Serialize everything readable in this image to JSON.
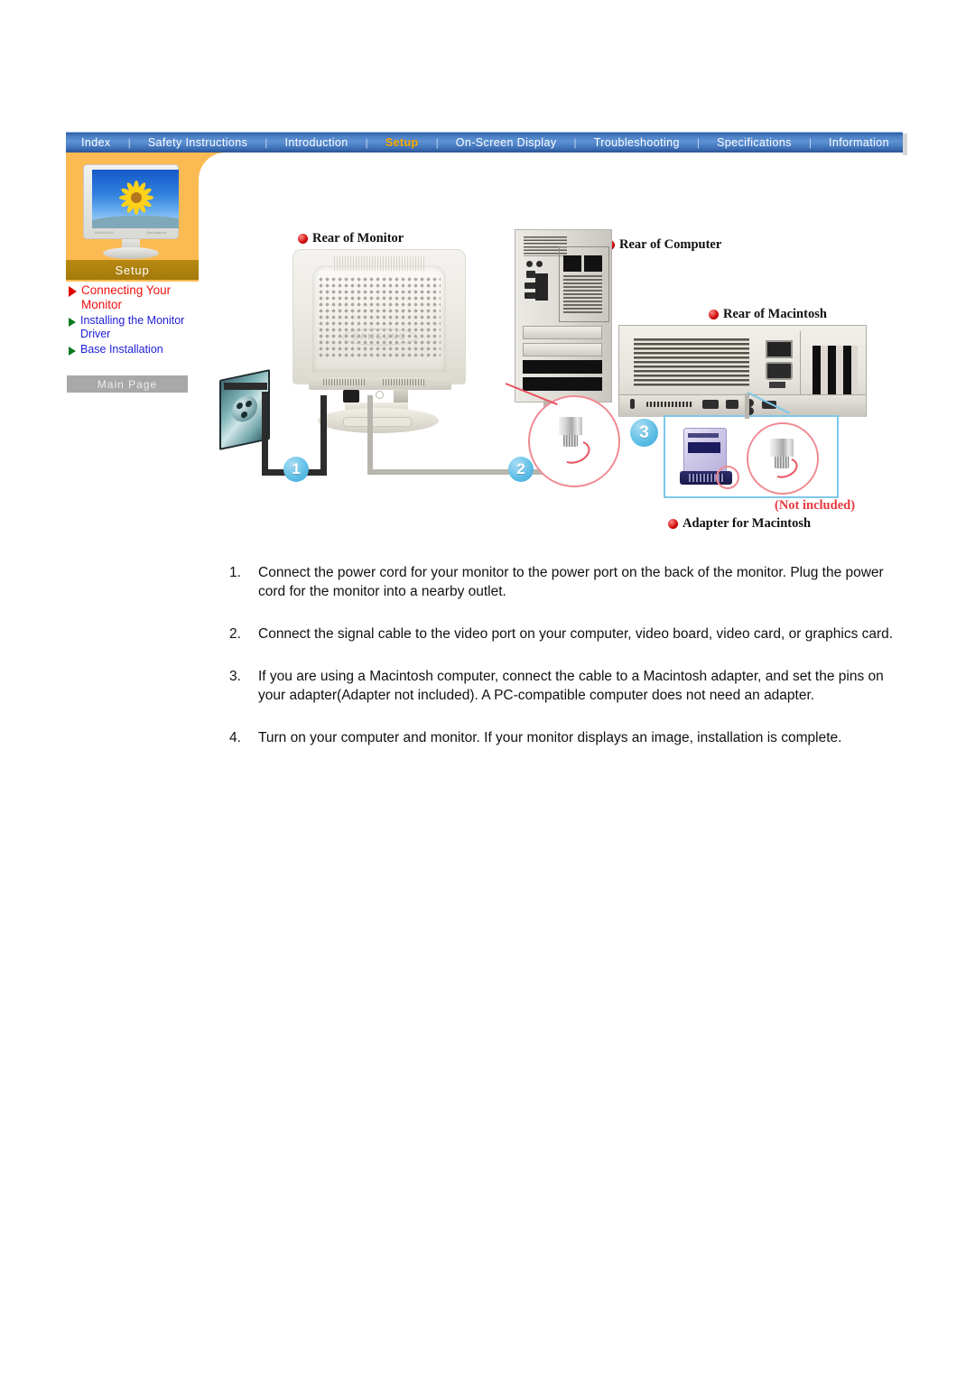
{
  "nav": {
    "items": [
      {
        "label": "Index",
        "active": false
      },
      {
        "label": "Safety Instructions",
        "active": false
      },
      {
        "label": "Introduction",
        "active": false
      },
      {
        "label": "Setup",
        "active": true
      },
      {
        "label": "On-Screen Display",
        "active": false
      },
      {
        "label": "Troubleshooting",
        "active": false
      },
      {
        "label": "Specifications",
        "active": false
      },
      {
        "label": "Information",
        "active": false
      }
    ],
    "separator": "|",
    "active_color": "#ffb000",
    "bar_color": "#4a7fc4"
  },
  "sidebar": {
    "section_title": "Setup",
    "thumbnail_alt": "monitor-with-sunflower-wallpaper",
    "brand_left": "SAMSUNG",
    "brand_right": "SyncMaster",
    "items": [
      {
        "label": "Connecting Your Monitor",
        "current": true,
        "arrow_color": "#e00000"
      },
      {
        "label": "Installing the Monitor Driver",
        "current": false,
        "arrow_color": "#0a7a23"
      },
      {
        "label": "Base Installation",
        "current": false,
        "arrow_color": "#0a7a23"
      }
    ],
    "main_page_label": "Main Page"
  },
  "diagram": {
    "labels": {
      "rear_of_monitor": "Rear of Monitor",
      "rear_of_computer": "Rear of Computer",
      "rear_of_macintosh": "Rear of  Macintosh",
      "adapter_for_macintosh": "Adapter for Macintosh",
      "not_included": "(Not included)"
    },
    "badges": [
      "1",
      "2",
      "3"
    ],
    "monitor_logo": "SAMSUNG"
  },
  "instructions": [
    {
      "number": "1.",
      "text": "Connect the power cord for your monitor to the power port on the back of the monitor. Plug the power cord for the monitor into a nearby outlet."
    },
    {
      "number": "2.",
      "text": "Connect the signal cable to the video port on your computer, video board, video card, or graphics card."
    },
    {
      "number": "3.",
      "text": "If you are using a Macintosh computer, connect the cable to a Macintosh adapter, and set the pins on your adapter(Adapter not included). A PC-compatible computer does not need an adapter."
    },
    {
      "number": "4.",
      "text": "Turn on your computer and monitor. If your monitor displays an image, installation is complete."
    }
  ]
}
